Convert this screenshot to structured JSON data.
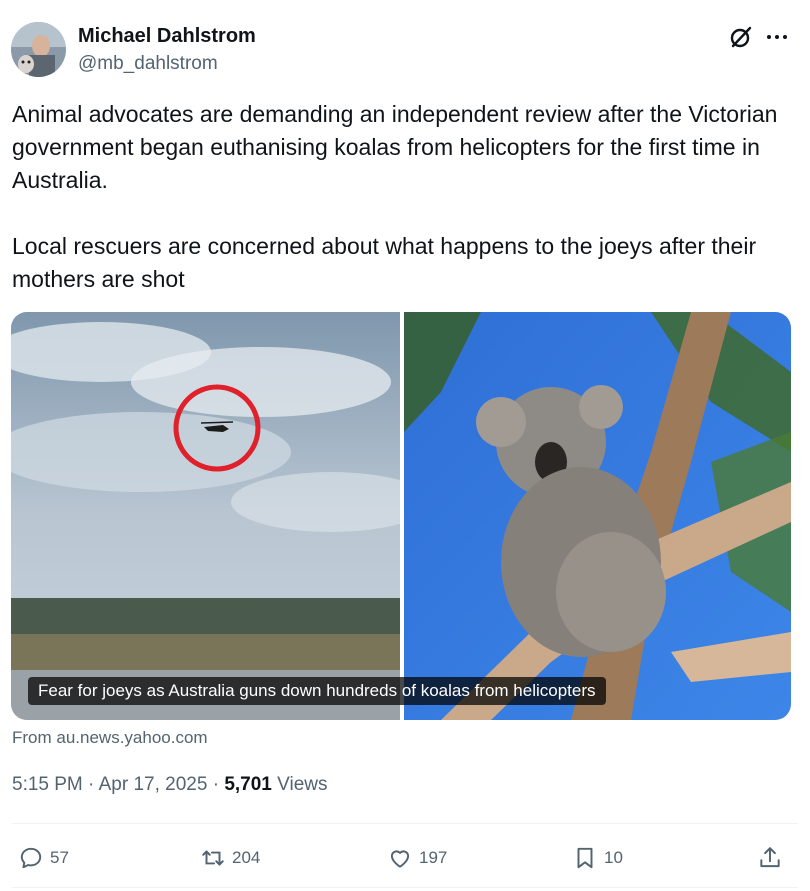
{
  "author": {
    "name": "Michael Dahlstrom",
    "handle": "@mb_dahlstrom"
  },
  "tweet": {
    "text": "Animal advocates are demanding an independent review after the Victorian government began euthanising koalas from helicopters for the first time in Australia.\n\nLocal rescuers are concerned about what happens to the joeys after their mothers are shot"
  },
  "media": {
    "caption": "Fear for joeys as Australia guns down hundreds of koalas from helicopters"
  },
  "card": {
    "source": "From au.news.yahoo.com"
  },
  "meta": {
    "time": "5:15 PM",
    "separator": " · ",
    "date": "Apr 17, 2025",
    "separator2": " · ",
    "views_count": "5,701",
    "views_label": " Views"
  },
  "actions": {
    "replies": "57",
    "reposts": "204",
    "likes": "197",
    "bookmarks": "10"
  },
  "icons": {
    "grok": "grok-icon",
    "more": "more-icon",
    "reply": "reply-icon",
    "repost": "repost-icon",
    "like": "heart-icon",
    "bookmark": "bookmark-icon",
    "share": "share-icon"
  },
  "colors": {
    "text_primary": "#0f1419",
    "text_secondary": "#536471",
    "divider": "#eff3f4",
    "circle_annotation": "#e0202a"
  }
}
